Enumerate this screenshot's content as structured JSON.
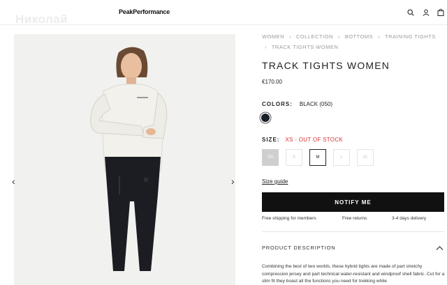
{
  "watermark": "Николай",
  "header": {
    "logo": "PeakPerformance",
    "icons": [
      "search-icon",
      "user-icon",
      "bag-icon"
    ]
  },
  "gallery": {
    "prev_arrow": "‹",
    "next_arrow": "›"
  },
  "breadcrumb": [
    "WOMEN",
    "COLLECTION",
    "BOTTOMS",
    "TRAINING TIGHTS",
    "TRACK TIGHTS WOMEN"
  ],
  "breadcrumb_separator": "›",
  "product": {
    "title": "TRACK TIGHTS WOMEN",
    "price": "€170.00"
  },
  "colors": {
    "label": "COLORS:",
    "selected": "BLACK (050)",
    "swatch_color": "#1a1f2b"
  },
  "size": {
    "label": "SIZE:",
    "status": "XS - OUT OF STOCK",
    "options": [
      "XS",
      "S",
      "M",
      "L",
      "XL"
    ]
  },
  "size_guide": "Size guide",
  "notify_button": "NOTIFY ME",
  "perks": [
    "Free shipping for members",
    "Free returns",
    "3-4 days delivery"
  ],
  "description": {
    "heading": "PRODUCT DESCRIPTION",
    "text": "Combining the best of two worlds, these hybrid tights are made of part stretchy compression jersey and part technical water-resistant and windproof shell fabric. Cut for a slim fit they boast all the functions you need for trekking while"
  },
  "colors_palette": {
    "oos_red": "#d33333",
    "button_black": "#111111"
  }
}
